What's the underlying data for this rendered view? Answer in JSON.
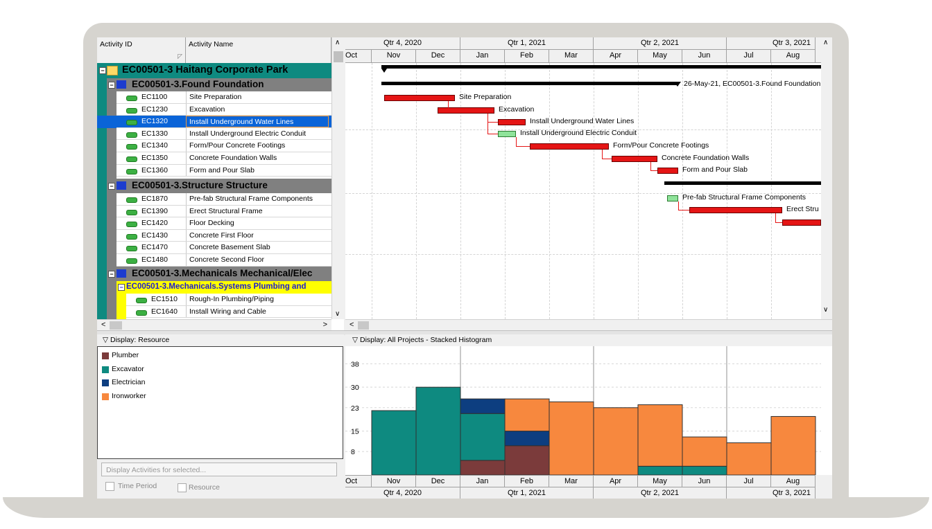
{
  "grid": {
    "col_activity_id": "Activity ID",
    "col_activity_name": "Activity Name",
    "project": {
      "label": "EC00501-3  Haitang Corporate Park"
    },
    "wbs_found": "EC00501-3.Found  Foundation",
    "wbs_structure": "EC00501-3.Structure  Structure",
    "wbs_mech": "EC00501-3.Mechanicals  Mechanical/Elec",
    "wbs_systems": "EC00501-3.Mechanicals.Systems  Plumbing and",
    "foundation_activities": [
      {
        "id": "EC1100",
        "name": "Site Preparation"
      },
      {
        "id": "EC1230",
        "name": "Excavation"
      },
      {
        "id": "EC1320",
        "name": "Install Underground Water Lines"
      },
      {
        "id": "EC1330",
        "name": "Install Underground Electric Conduit"
      },
      {
        "id": "EC1340",
        "name": "Form/Pour Concrete Footings"
      },
      {
        "id": "EC1350",
        "name": "Concrete Foundation Walls"
      },
      {
        "id": "EC1360",
        "name": "Form and Pour Slab"
      }
    ],
    "structure_activities": [
      {
        "id": "EC1870",
        "name": "Pre-fab Structural Frame Components"
      },
      {
        "id": "EC1390",
        "name": "Erect Structural Frame"
      },
      {
        "id": "EC1420",
        "name": "Floor Decking"
      },
      {
        "id": "EC1430",
        "name": "Concrete First Floor"
      },
      {
        "id": "EC1470",
        "name": "Concrete Basement Slab"
      },
      {
        "id": "EC1480",
        "name": "Concrete Second Floor"
      }
    ],
    "systems_activities": [
      {
        "id": "EC1510",
        "name": "Rough-In Plumbing/Piping"
      },
      {
        "id": "EC1640",
        "name": "Install Wiring and Cable"
      }
    ]
  },
  "timescale": {
    "quarters": [
      "Qtr 4, 2020",
      "Qtr 1, 2021",
      "Qtr 2, 2021",
      "Qtr 3, 2021"
    ],
    "months": [
      "Oct",
      "Nov",
      "Dec",
      "Jan",
      "Feb",
      "Mar",
      "Apr",
      "May",
      "Jun",
      "Jul",
      "Aug"
    ]
  },
  "gantt_labels": {
    "found_summary": "26-May-21, EC00501-3.Found  Foundation",
    "site_prep": "Site Preparation",
    "excavation": "Excavation",
    "water": "Install Underground Water Lines",
    "electric": "Install Underground Electric Conduit",
    "footings": "Form/Pour Concrete Footings",
    "walls": "Concrete Foundation Walls",
    "slab": "Form and Pour Slab",
    "prefab": "Pre-fab Structural Frame Components",
    "erect": "Erect Stru"
  },
  "resource_panel": {
    "title": "Display: Resource",
    "resources": [
      {
        "name": "Plumber",
        "color": "#7b3b3b"
      },
      {
        "name": "Excavator",
        "color": "#0e8a80"
      },
      {
        "name": "Electrician",
        "color": "#0d3e80"
      },
      {
        "name": "Ironworker",
        "color": "#f7883e"
      }
    ],
    "display_activities_placeholder": "Display Activities for selected...",
    "time_period": "Time Period",
    "resource": "Resource"
  },
  "histogram": {
    "title": "Display: All Projects - Stacked Histogram",
    "yticks": [
      "38",
      "30",
      "23",
      "15",
      "8"
    ]
  },
  "chart_data": {
    "type": "bar",
    "stacked": true,
    "categories": [
      "Nov",
      "Dec",
      "Jan",
      "Feb",
      "Mar",
      "Apr",
      "May",
      "Jun",
      "Jul",
      "Aug"
    ],
    "series": [
      {
        "name": "Plumber",
        "values": [
          0,
          0,
          5,
          10,
          0,
          0,
          0,
          0,
          0,
          0
        ]
      },
      {
        "name": "Excavator",
        "values": [
          22,
          30,
          16,
          0,
          0,
          0,
          3,
          3,
          0,
          0
        ]
      },
      {
        "name": "Electrician",
        "values": [
          0,
          0,
          5,
          5,
          0,
          0,
          0,
          0,
          0,
          0
        ]
      },
      {
        "name": "Ironworker",
        "values": [
          0,
          0,
          0,
          11,
          25,
          23,
          21,
          10,
          11,
          20
        ]
      }
    ],
    "ylim": [
      0,
      44
    ]
  }
}
